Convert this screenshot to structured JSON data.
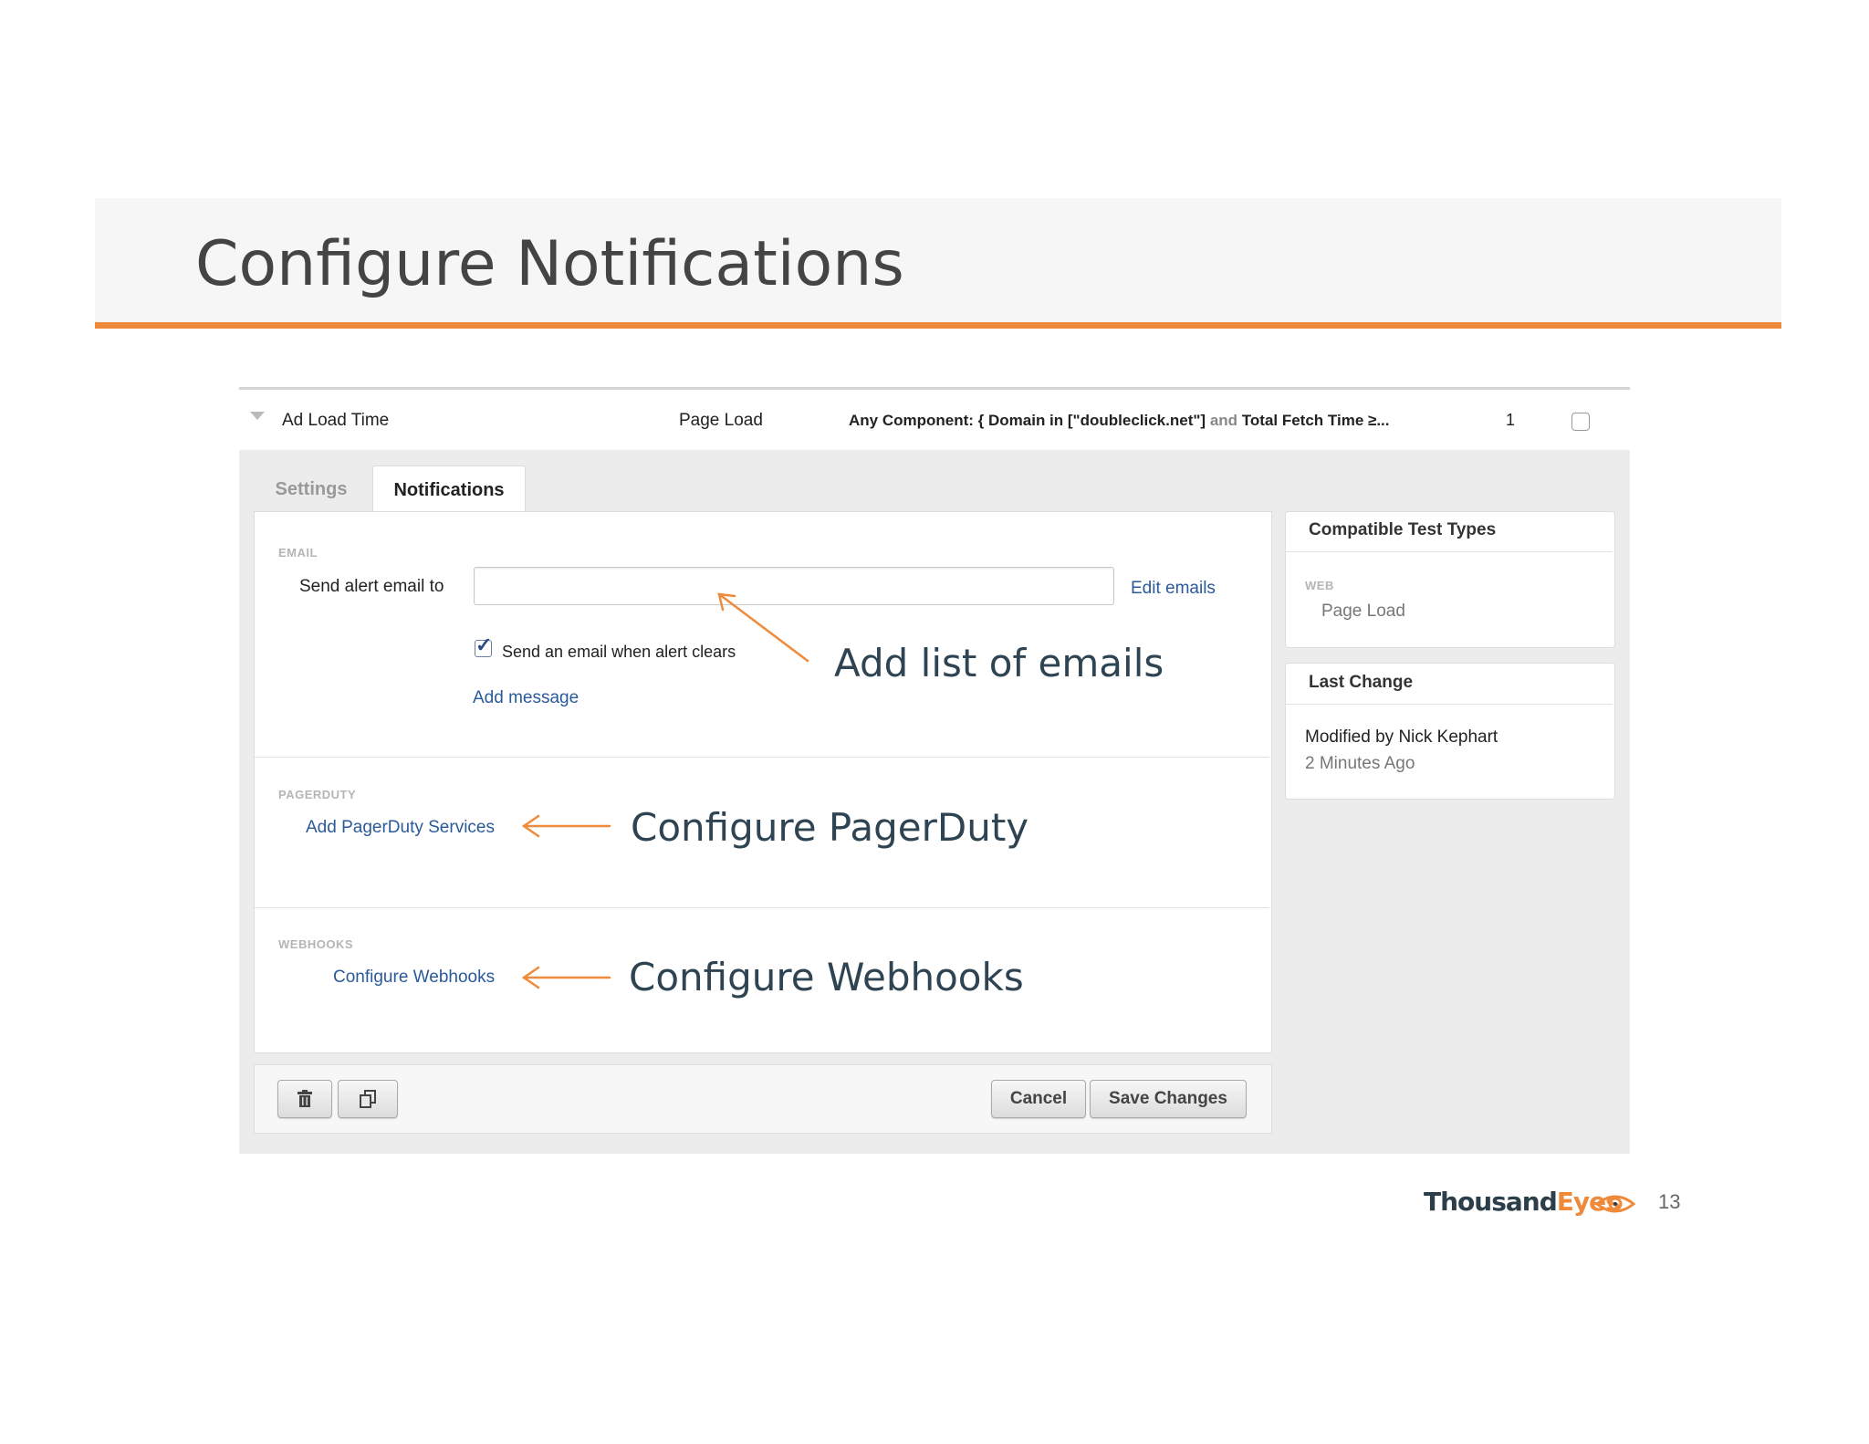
{
  "slide": {
    "title": "Configure Notifications",
    "page_number": "13",
    "logo": {
      "part1": "Thousand",
      "part2": "Eyes"
    }
  },
  "alert_row": {
    "name": "Ad Load Time",
    "test_type": "Page Load",
    "condition_part1": "Any Component: { Domain in [\"doubleclick.net\"] ",
    "condition_and": "and",
    "condition_part2": " Total Fetch Time ≥...",
    "count": "1"
  },
  "tabs": {
    "settings": "Settings",
    "notifications": "Notifications"
  },
  "email": {
    "section_label": "EMAIL",
    "send_label": "Send alert email to",
    "input_value": "",
    "edit_link": "Edit emails",
    "clears_label": "Send an email when alert clears",
    "clears_checked": true,
    "add_message": "Add message"
  },
  "pagerduty": {
    "section_label": "PAGERDUTY",
    "link": "Add PagerDuty Services"
  },
  "webhooks": {
    "section_label": "WEBHOOKS",
    "link": "Configure Webhooks"
  },
  "buttons": {
    "delete_icon": "trash-icon",
    "copy_icon": "copy-icon",
    "cancel": "Cancel",
    "save": "Save Changes"
  },
  "compatible": {
    "title": "Compatible Test Types",
    "category": "WEB",
    "value": "Page Load"
  },
  "last_change": {
    "title": "Last Change",
    "modified_by": "Modified by Nick Kephart",
    "time": "2 Minutes Ago"
  },
  "annotations": {
    "emails": "Add list of emails",
    "pagerduty": "Configure PagerDuty",
    "webhooks": "Configure Webhooks"
  },
  "colors": {
    "accent": "#ef8a3a",
    "link": "#2a5a9a",
    "annotation_text": "#2f4452"
  }
}
